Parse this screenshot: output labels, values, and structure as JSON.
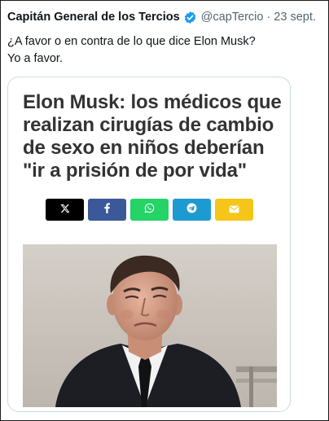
{
  "tweet": {
    "author_name": "Capitán General de los Tercios",
    "handle": "@capTercio",
    "separator": "·",
    "date": "23 sept.",
    "text_line1": "¿A favor o en contra de lo que dice Elon Musk?",
    "text_line2": "Yo a favor."
  },
  "card": {
    "headline": "Elon Musk: los médicos que realizan cirugías de cambio de sexo en niños deberían \"ir a prisión de por vida\"",
    "share_buttons": [
      {
        "name": "x",
        "icon": "x-logo-icon",
        "color": "#000000"
      },
      {
        "name": "facebook",
        "icon": "facebook-icon",
        "color": "#3b5998"
      },
      {
        "name": "whatsapp",
        "icon": "whatsapp-icon",
        "color": "#25d366"
      },
      {
        "name": "telegram",
        "icon": "telegram-icon",
        "color": "#1d9bd1"
      },
      {
        "name": "email",
        "icon": "envelope-icon",
        "color": "#f5c518"
      }
    ],
    "image_icon": "portrait-photo"
  },
  "colors": {
    "verified_badge": "#1d9bf0",
    "secondary_text": "#536471",
    "headline_text": "#333333"
  }
}
